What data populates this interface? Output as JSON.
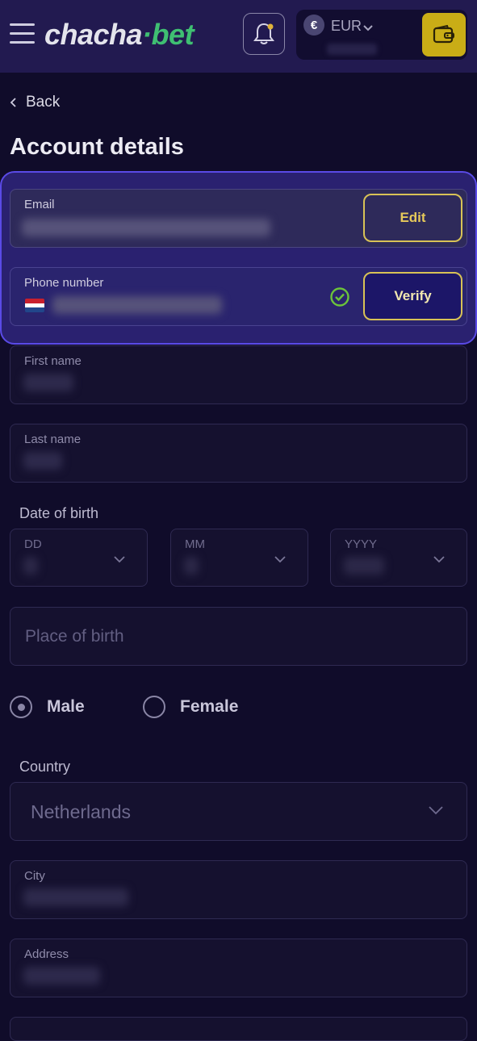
{
  "header": {
    "logo_part1": "chacha",
    "logo_part2": "·bet",
    "currency_symbol": "€",
    "currency_code": "EUR",
    "accent_color": "#c9ad16"
  },
  "nav": {
    "back_label": "Back"
  },
  "page": {
    "title": "Account details"
  },
  "form": {
    "email": {
      "label": "Email",
      "action_label": "Edit"
    },
    "phone": {
      "label": "Phone number",
      "action_label": "Verify",
      "verified": true,
      "flag": "Netherlands"
    },
    "first_name": {
      "label": "First name"
    },
    "last_name": {
      "label": "Last name"
    },
    "date_of_birth": {
      "label": "Date of birth",
      "day_label": "DD",
      "month_label": "MM",
      "year_label": "YYYY"
    },
    "place_of_birth": {
      "placeholder": "Place of birth"
    },
    "gender": {
      "male_label": "Male",
      "female_label": "Female",
      "selected": "Male"
    },
    "country": {
      "label": "Country",
      "value": "Netherlands"
    },
    "city": {
      "label": "City"
    },
    "address": {
      "label": "Address"
    }
  }
}
